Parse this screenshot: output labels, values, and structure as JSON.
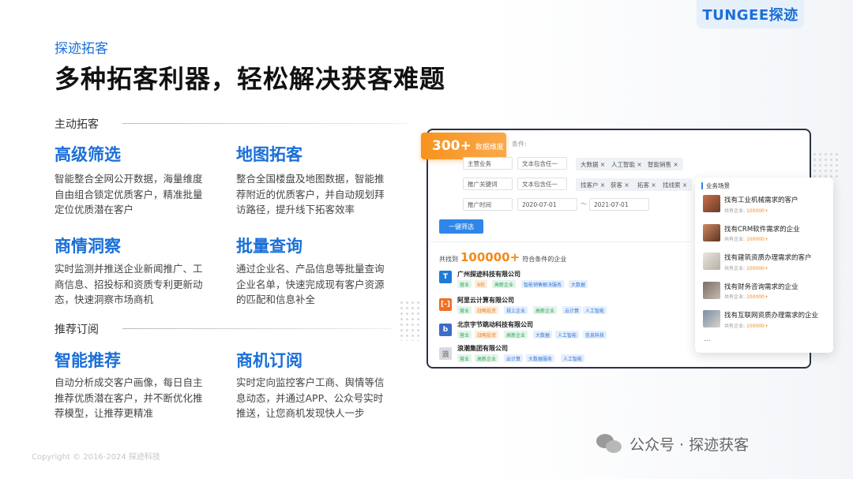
{
  "logo": "TUNGEE探迹",
  "tag": "探迹拓客",
  "title": "多种拓客利器，轻松解决获客难题",
  "section1": "主动拓客",
  "section2": "推荐订阅",
  "features": [
    {
      "heading": "高级筛选",
      "desc": "智能整合全网公开数据，海量维度自由组合锁定优质客户，精准批量定位优质潜在客户"
    },
    {
      "heading": "地图拓客",
      "desc": "整合全国楼盘及地图数据，智能推荐附近的优质客户，并自动规划拜访路径，提升线下拓客效率"
    },
    {
      "heading": "商情洞察",
      "desc": "实时监测并推送企业新闻推广、工商信息、招投标和资质专利更新动态，快速洞察市场商机"
    },
    {
      "heading": "批量查询",
      "desc": "通过企业名、产品信息等批量查询企业名单，快速完成现有客户资源的匹配和信息补全"
    },
    {
      "heading": "智能推荐",
      "desc": "自动分析成交客户画像，每日自主推荐优质潜在客户，并不断优化推荐模型，让推荐更精准"
    },
    {
      "heading": "商机订阅",
      "desc": "实时定向监控客户工商、舆情等信息动态，并通过APP、公众号实时推送，让您商机发现快人一步"
    }
  ],
  "copyright": "Copyright © 2016-2024 探迹科技",
  "wechat": "公众号 · 探迹获客",
  "mock": {
    "badge_num": "300+",
    "badge_text": "数据维度",
    "cond_label": "条件:",
    "rows": [
      {
        "field": "主营业务",
        "op": "文本包含任一",
        "tags": [
          "大数据 ×",
          "人工智能 ×",
          "智能销售 ×"
        ]
      },
      {
        "field": "推广关键词",
        "op": "文本包含任一",
        "tags": [
          "找客户 ×",
          "获客 ×",
          "拓客 ×",
          "找线索 ×"
        ]
      },
      {
        "field": "推广时间",
        "op": "2020-07-01",
        "sep": "～",
        "op2": "2021-07-01"
      }
    ],
    "search_btn": "一键筛选",
    "found_pre": "共找到",
    "found_num": "100000+",
    "found_post": "符合条件的企业",
    "companies": [
      {
        "name": "广州探迹科技有限公司",
        "tags": [
          "营业",
          "B轮",
          "高新企业",
          "智能销售解决服务",
          "大数据"
        ],
        "logo_color": "#1f7ad9",
        "logo_text": "T"
      },
      {
        "name": "阿里云计算有限公司",
        "tags": [
          "营业",
          "战略投资",
          "规上企业",
          "高新企业",
          "云计算",
          "人工智能"
        ],
        "logo_color": "#f36e21",
        "logo_text": "[-]"
      },
      {
        "name": "北京字节跳动科技有限公司",
        "tags": [
          "营业",
          "战略投资",
          "高新企业",
          "大数据",
          "人工智能",
          "信息科技"
        ],
        "logo_color": "#3c6bc9",
        "logo_text": "b"
      },
      {
        "name": "浪潮集团有限公司",
        "tags": [
          "营业",
          "高新企业",
          "云计算",
          "大数据服务",
          "人工智能"
        ],
        "logo_color": "#d8dbe0",
        "logo_text": "浪"
      }
    ],
    "panel_title": "业务场景",
    "scenarios": [
      {
        "title": "找有工业机械需求的客户",
        "sub": "共有企业:",
        "num": "100000+"
      },
      {
        "title": "找有CRM软件需求的企业",
        "sub": "共有企业:",
        "num": "100000+"
      },
      {
        "title": "找有建筑资质办理需求的客户",
        "sub": "共有企业:",
        "num": "100000+"
      },
      {
        "title": "找有财务咨询需求的企业",
        "sub": "共有企业:",
        "num": "100000+"
      },
      {
        "title": "找有互联网资质办理需求的企业",
        "sub": "共有企业:",
        "num": "100000+"
      }
    ],
    "ellipsis": "..."
  }
}
